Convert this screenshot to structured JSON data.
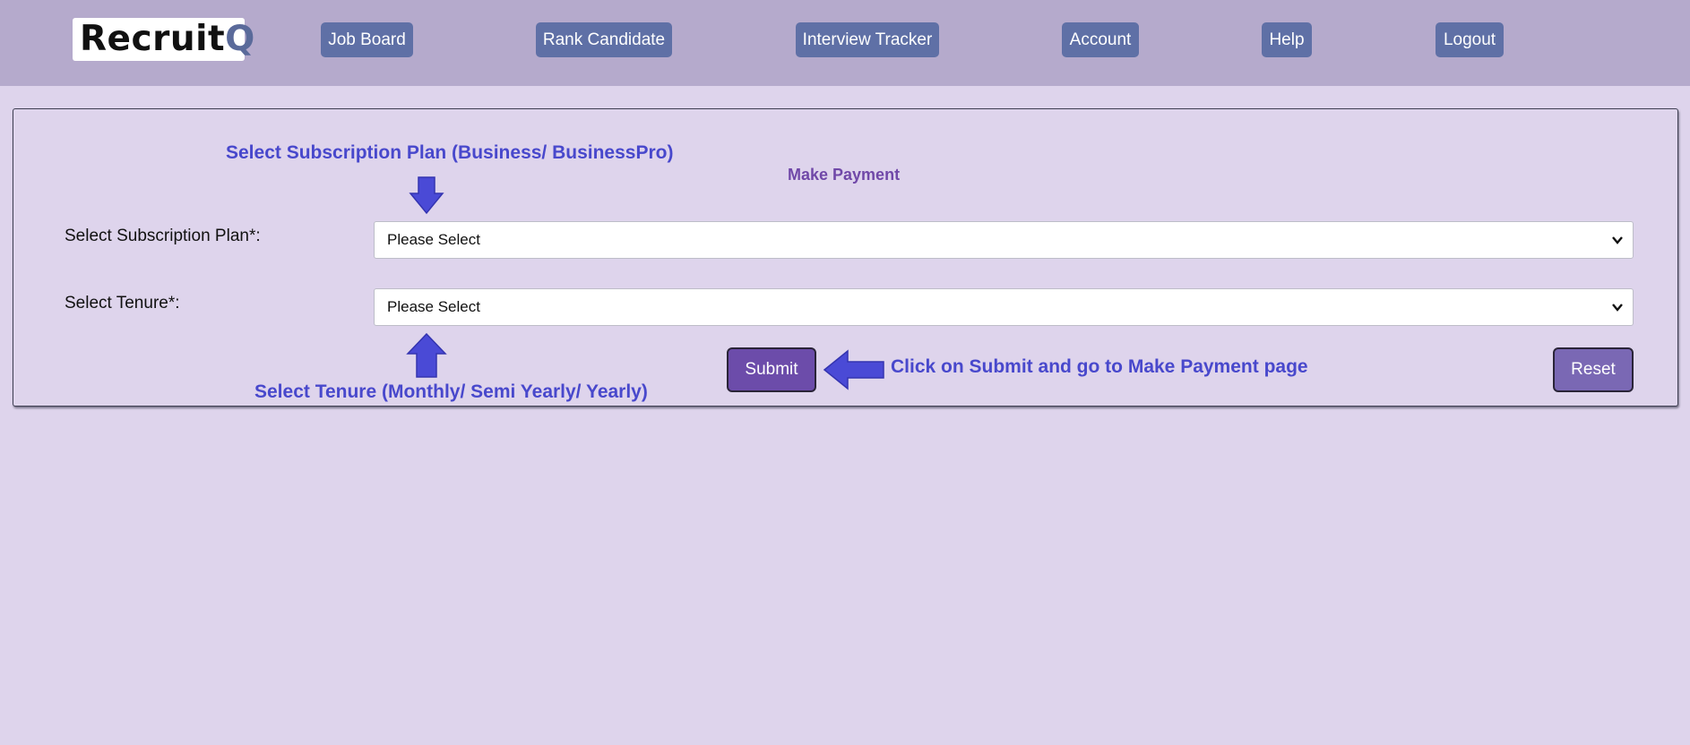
{
  "header": {
    "logo_main": "Recruit",
    "logo_accent": "Q",
    "nav": [
      {
        "label": "Job Board"
      },
      {
        "label": "Rank Candidate"
      },
      {
        "label": "Interview Tracker"
      },
      {
        "label": "Account"
      },
      {
        "label": "Help"
      },
      {
        "label": "Logout"
      }
    ]
  },
  "form": {
    "title": "Make Payment",
    "subscription_label": "Select Subscription Plan*:",
    "subscription_value": "Please Select",
    "tenure_label": "Select Tenure*:",
    "tenure_value": "Please Select",
    "submit_label": "Submit",
    "reset_label": "Reset"
  },
  "annotations": {
    "subscription_hint": "Select Subscription Plan (Business/ BusinessPro)",
    "tenure_hint": "Select Tenure (Monthly/ Semi Yearly/ Yearly)",
    "submit_hint": "Click on Submit and go to Make Payment page"
  },
  "colors": {
    "page_bg": "#ded4ec",
    "header_bg": "#b5aacc",
    "nav_button": "#5f70a6",
    "submit_button": "#6c4caa",
    "reset_button": "#7a68b4",
    "annotation": "#4848cc",
    "title": "#7048a8"
  }
}
